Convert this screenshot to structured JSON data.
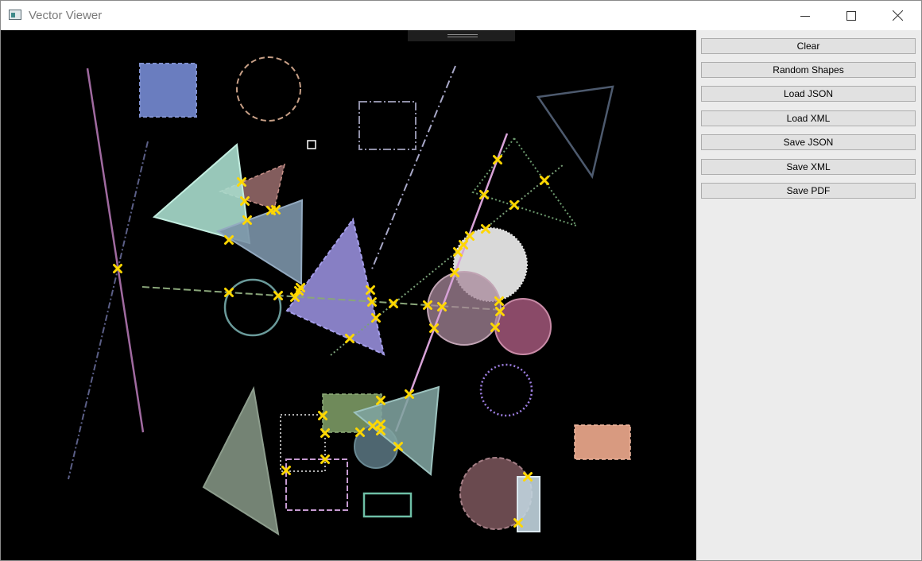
{
  "window": {
    "title": "Vector Viewer"
  },
  "buttons": {
    "clear": "Clear",
    "random_shapes": "Random Shapes",
    "load_json": "Load JSON",
    "load_xml": "Load XML",
    "save_json": "Save JSON",
    "save_xml": "Save XML",
    "save_pdf": "Save PDF"
  },
  "icons": {
    "minimize": "minimize-icon",
    "maximize": "maximize-icon",
    "close": "close-icon"
  },
  "colors": {
    "canvas_background": "#000000",
    "sidebar_background": "#ececec",
    "intersection_marker": "#ffd700"
  }
}
